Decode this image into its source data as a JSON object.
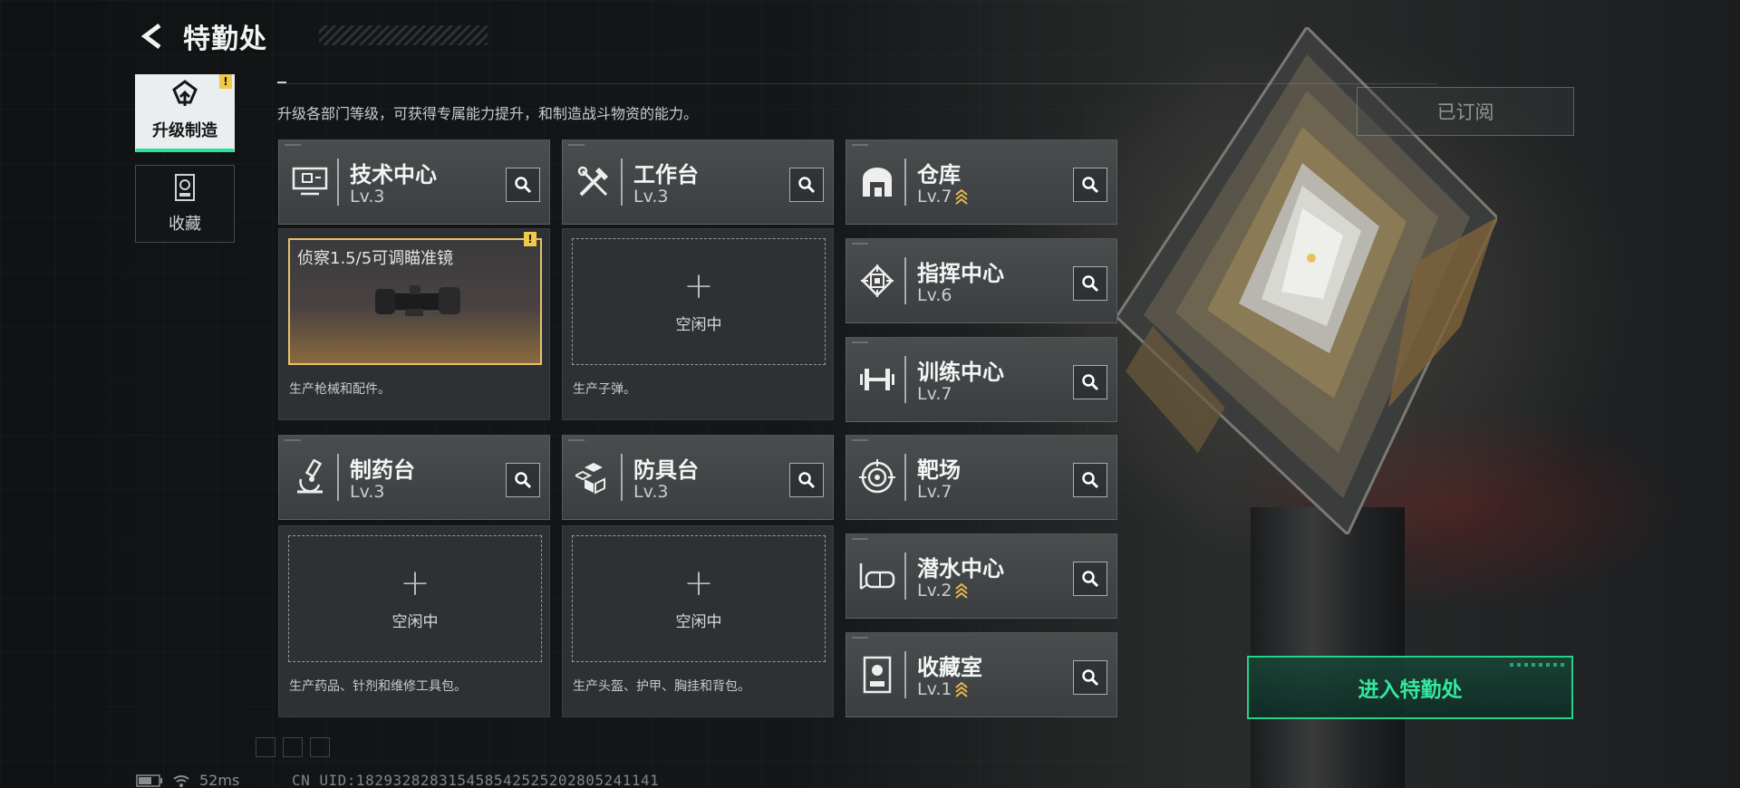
{
  "header": {
    "title": "特勤处"
  },
  "subtitle": "升级各部门等级，可获得专属能力提升，和制造战斗物资的能力。",
  "nav": [
    {
      "label": "升级制造",
      "active": true,
      "badge": "!"
    },
    {
      "label": "收藏",
      "active": false
    }
  ],
  "departments": [
    {
      "name": "技术中心",
      "level": "Lv.3",
      "upgradable": false,
      "icon": "monitor-icon"
    },
    {
      "name": "工作台",
      "level": "Lv.3",
      "upgradable": false,
      "icon": "tools-icon"
    },
    {
      "name": "制药台",
      "level": "Lv.3",
      "upgradable": false,
      "icon": "microscope-icon"
    },
    {
      "name": "防具台",
      "level": "Lv.3",
      "upgradable": false,
      "icon": "cubes-icon"
    },
    {
      "name": "仓库",
      "level": "Lv.7",
      "upgradable": true,
      "icon": "warehouse-icon"
    },
    {
      "name": "指挥中心",
      "level": "Lv.6",
      "upgradable": false,
      "icon": "chip-icon"
    },
    {
      "name": "训练中心",
      "level": "Lv.7",
      "upgradable": false,
      "icon": "dumbbell-icon"
    },
    {
      "name": "靶场",
      "level": "Lv.7",
      "upgradable": false,
      "icon": "target-icon"
    },
    {
      "name": "潜水中心",
      "level": "Lv.2",
      "upgradable": true,
      "icon": "diving-mask-icon"
    },
    {
      "name": "收藏室",
      "level": "Lv.1",
      "upgradable": true,
      "icon": "collection-icon"
    }
  ],
  "slots": {
    "tech": {
      "item": "侦察1.5/5可调瞄准镜",
      "badge": "!",
      "desc": "生产枪械和配件。"
    },
    "workbench": {
      "state": "空闲中",
      "desc": "生产子弹。"
    },
    "pharmacy": {
      "state": "空闲中",
      "desc": "生产药品、针剂和维修工具包。"
    },
    "armor": {
      "state": "空闲中",
      "desc": "生产头盔、护甲、胸挂和背包。"
    }
  },
  "subscribed_label": "已订阅",
  "enter_button": "进入特勤处",
  "status": {
    "ping": "52ms",
    "uid": "CN UID:18293282831545854252520280524114​1"
  },
  "colors": {
    "accent": "#34e89e",
    "warning": "#f0c84a",
    "item_border": "#e9c06a"
  }
}
